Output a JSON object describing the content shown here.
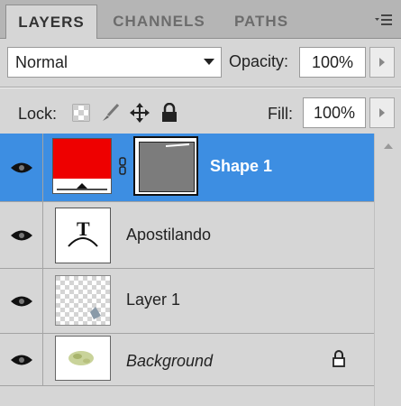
{
  "tabs": [
    {
      "label": "LAYERS",
      "active": true
    },
    {
      "label": "CHANNELS",
      "active": false
    },
    {
      "label": "PATHS",
      "active": false
    }
  ],
  "panel_menu_icon": "panel-menu-icon",
  "blend_mode": {
    "value": "Normal",
    "icon": "chevron-down-icon"
  },
  "opacity": {
    "label": "Opacity:",
    "value": "100%"
  },
  "lock": {
    "label": "Lock:",
    "icons": [
      "lock-transparent-pixels-icon",
      "lock-image-pixels-icon",
      "lock-position-icon",
      "lock-all-icon"
    ]
  },
  "fill": {
    "label": "Fill:",
    "value": "100%"
  },
  "layers": [
    {
      "name": "Shape 1",
      "selected": true,
      "visible": true,
      "fill_color": "#ee0000",
      "type": "shape"
    },
    {
      "name": "Apostilando",
      "selected": false,
      "visible": true,
      "type": "text",
      "thumb_glyph": "T"
    },
    {
      "name": "Layer 1",
      "selected": false,
      "visible": true,
      "type": "pixel"
    },
    {
      "name": "Background",
      "selected": false,
      "visible": true,
      "type": "background",
      "locked": true
    }
  ],
  "colors": {
    "selection": "#3d8ee2",
    "panel": "#d6d6d6",
    "tabbar": "#b5b5b5"
  }
}
